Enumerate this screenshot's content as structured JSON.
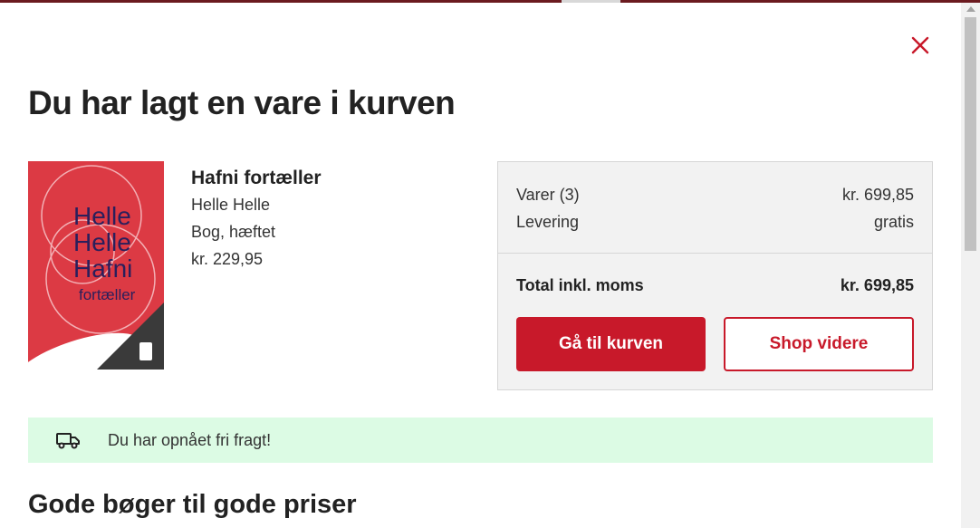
{
  "modal": {
    "close_icon": "close-icon",
    "title": "Du har lagt en vare i kurven"
  },
  "product": {
    "title": "Hafni fortæller",
    "author": "Helle Helle",
    "format": "Bog, hæftet",
    "price": "kr. 229,95",
    "cover": {
      "line1": "Helle",
      "line2": "Helle",
      "line3": "Hafni",
      "line4": "fortæller"
    }
  },
  "summary": {
    "items_label": "Varer (3)",
    "items_value": "kr. 699,85",
    "delivery_label": "Levering",
    "delivery_value": "gratis",
    "total_label": "Total inkl. moms",
    "total_value": "kr. 699,85",
    "go_to_cart_label": "Gå til kurven",
    "continue_shopping_label": "Shop videre"
  },
  "shipping": {
    "icon": "truck-icon",
    "message": "Du har opnået fri fragt!"
  },
  "recommendations": {
    "title": "Gode bøger til gode priser"
  },
  "colors": {
    "accent": "#c8192a",
    "banner_bg": "#dcfbe4",
    "summary_bg": "#f2f2f2"
  }
}
